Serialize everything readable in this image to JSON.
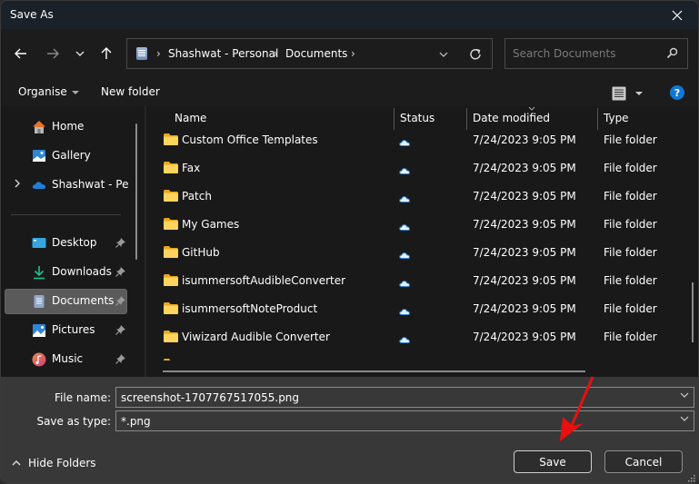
{
  "window": {
    "title": "Save As",
    "close_icon": "close-icon"
  },
  "navigation": {
    "back_icon": "arrow-left-icon",
    "forward_icon": "arrow-right-icon",
    "recent_icon": "chevron-down-icon",
    "up_icon": "arrow-up-icon",
    "breadcrumb": [
      "Shashwat - Personal",
      "Documents"
    ],
    "refresh_icon": "refresh-icon",
    "search_placeholder": "Search Documents"
  },
  "toolbar": {
    "organise_label": "Organise",
    "new_folder_label": "New folder",
    "view_icon": "list-view-icon",
    "help_icon": "help-icon"
  },
  "sidebar": {
    "items": [
      {
        "label": "Home",
        "icon": "home-icon",
        "pinned": false
      },
      {
        "label": "Gallery",
        "icon": "gallery-icon",
        "pinned": false
      },
      {
        "label": "Shashwat - Pers",
        "icon": "onedrive-icon",
        "pinned": false,
        "expandable": true
      },
      {
        "label": "Desktop",
        "icon": "desktop-icon",
        "pinned": true
      },
      {
        "label": "Downloads",
        "icon": "downloads-icon",
        "pinned": true
      },
      {
        "label": "Documents",
        "icon": "documents-icon",
        "pinned": true,
        "selected": true
      },
      {
        "label": "Pictures",
        "icon": "pictures-icon",
        "pinned": true
      },
      {
        "label": "Music",
        "icon": "music-icon",
        "pinned": true
      }
    ]
  },
  "file_list": {
    "columns": [
      "Name",
      "Status",
      "Date modified",
      "Type"
    ],
    "sorted_by": "Date modified",
    "rows": [
      {
        "name": "Custom Office Templates",
        "status": "cloud",
        "date": "7/24/2023 9:05 PM",
        "type": "File folder"
      },
      {
        "name": "Fax",
        "status": "cloud",
        "date": "7/24/2023 9:05 PM",
        "type": "File folder"
      },
      {
        "name": "Patch",
        "status": "cloud",
        "date": "7/24/2023 9:05 PM",
        "type": "File folder"
      },
      {
        "name": "My Games",
        "status": "cloud",
        "date": "7/24/2023 9:05 PM",
        "type": "File folder"
      },
      {
        "name": "GitHub",
        "status": "cloud",
        "date": "7/24/2023 9:05 PM",
        "type": "File folder"
      },
      {
        "name": "isummersoftAudibleConverter",
        "status": "cloud",
        "date": "7/24/2023 9:05 PM",
        "type": "File folder"
      },
      {
        "name": "isummersoftNoteProduct",
        "status": "cloud",
        "date": "7/24/2023 9:05 PM",
        "type": "File folder"
      },
      {
        "name": "Viwizard Audible Converter",
        "status": "cloud",
        "date": "7/24/2023 9:05 PM",
        "type": "File folder"
      }
    ]
  },
  "save_form": {
    "file_name_label": "File name:",
    "file_name_value": "screenshot-1707767517055.png",
    "save_type_label": "Save as type:",
    "save_type_value": "*.png",
    "hide_folders_label": "Hide Folders",
    "save_label": "Save",
    "cancel_label": "Cancel"
  },
  "colors": {
    "accent": "#0f78d4",
    "folder": "#f5c542",
    "annotation_arrow": "#e81010"
  }
}
